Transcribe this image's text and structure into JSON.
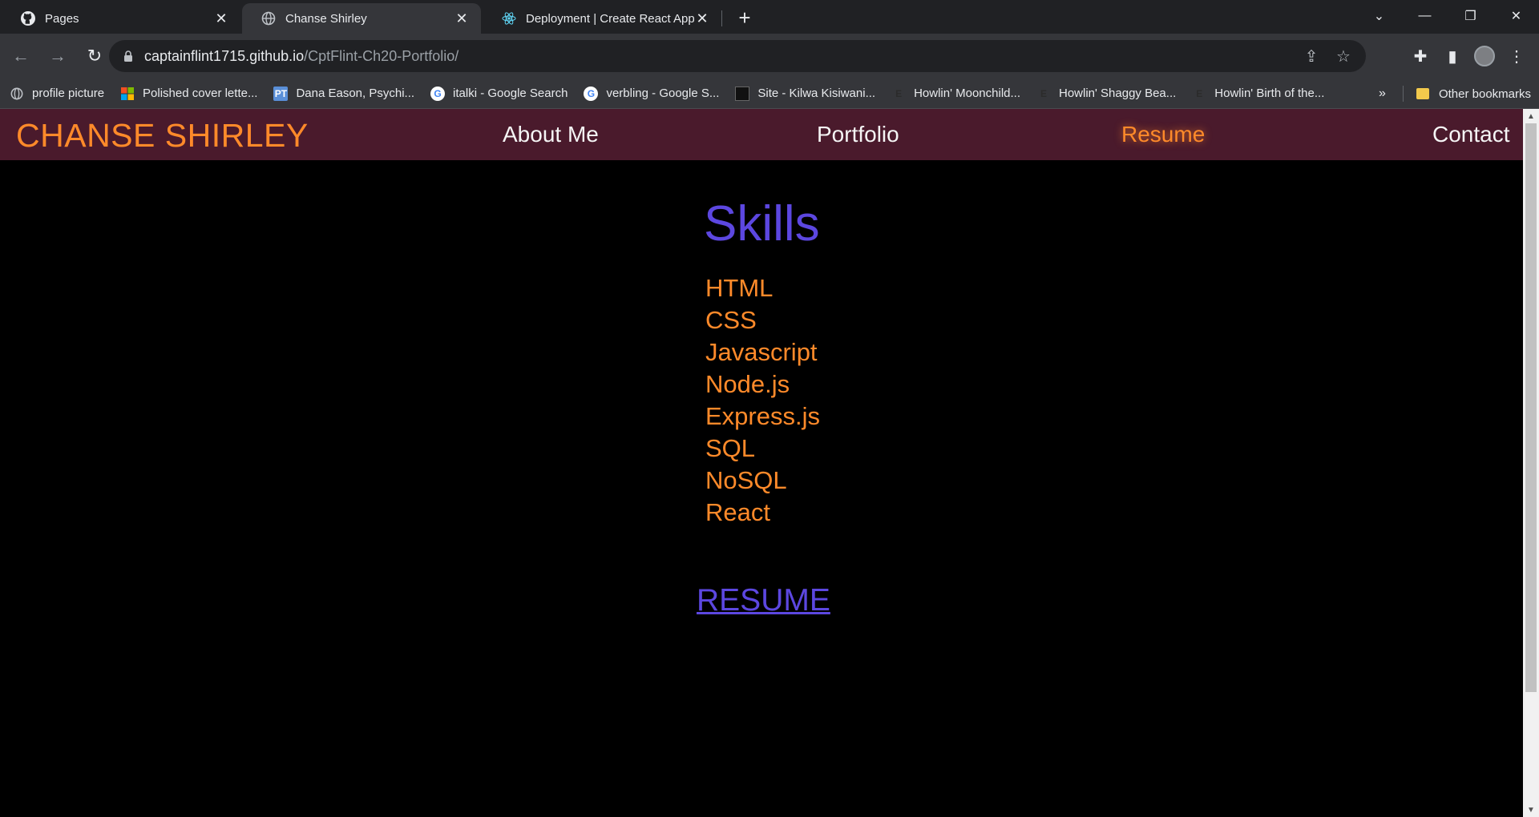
{
  "browser": {
    "tabs": [
      {
        "title": "Pages",
        "icon": "github-icon",
        "active": false
      },
      {
        "title": "Chanse Shirley",
        "icon": "globe-icon",
        "active": true
      },
      {
        "title": "Deployment | Create React App",
        "icon": "react-icon",
        "active": false
      }
    ],
    "url_host": "captainflint1715.github.io",
    "url_path": "/CptFlint-Ch20-Portfolio/",
    "bookmarks": [
      {
        "label": "profile picture",
        "icon": "globe-icon"
      },
      {
        "label": "Polished cover lette...",
        "icon": "microsoft-icon"
      },
      {
        "label": "Dana Eason, Psychi...",
        "icon": "pt-icon"
      },
      {
        "label": "italki - Google Search",
        "icon": "google-icon"
      },
      {
        "label": "verbling - Google S...",
        "icon": "google-icon"
      },
      {
        "label": "Site - Kilwa Kisiwani...",
        "icon": "site-icon"
      },
      {
        "label": "Howlin' Moonchild...",
        "icon": "e-icon"
      },
      {
        "label": "Howlin' Shaggy Bea...",
        "icon": "e-icon"
      },
      {
        "label": "Howlin' Birth of the...",
        "icon": "e-icon"
      }
    ],
    "bookmarks_overflow": "»",
    "other_bookmarks": "Other bookmarks"
  },
  "site": {
    "brand": "CHANSE SHIRLEY",
    "nav": [
      "About Me",
      "Portfolio",
      "Resume",
      "Contact"
    ],
    "active_nav": "Resume",
    "skills_title": "Skills",
    "skills": [
      "HTML",
      "CSS",
      "Javascript",
      "Node.js",
      "Express.js",
      "SQL",
      "NoSQL",
      "React"
    ],
    "resume_link": "RESUME"
  },
  "colors": {
    "header_bg": "#4a1a2c",
    "accent_orange": "#ff8a2a",
    "accent_purple": "#5c47e0",
    "page_bg": "#000000"
  }
}
